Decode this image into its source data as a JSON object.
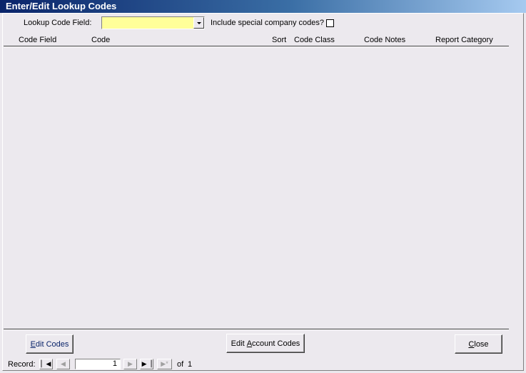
{
  "window": {
    "title": "Enter/Edit Lookup Codes"
  },
  "filter": {
    "lookup_label": "Lookup Code Field:",
    "lookup_value": "",
    "special_label": "Include special company codes?",
    "special_checked": false
  },
  "columns": [
    "Code Field",
    "Code",
    "Sort",
    "Code Class",
    "Code Notes",
    "Report Category"
  ],
  "rows": [],
  "buttons": {
    "edit_codes_pre": "",
    "edit_codes_ul": "E",
    "edit_codes_post": "dit Codes",
    "edit_account_pre": "Edit ",
    "edit_account_ul": "A",
    "edit_account_post": "ccount Codes",
    "close_pre": "",
    "close_ul": "C",
    "close_post": "lose"
  },
  "navigator": {
    "record_label": "Record:",
    "current": "1",
    "of_label": "of",
    "total": "1"
  },
  "icons": {
    "first": "first-record-icon",
    "prev": "prev-record-icon",
    "next": "next-record-icon",
    "last": "last-record-icon",
    "new": "new-record-icon"
  },
  "colors": {
    "title_start": "#0A246A",
    "title_end": "#A6CAF0",
    "combo_bg": "#FFFF99",
    "form_bg": "#ECE9EE"
  }
}
